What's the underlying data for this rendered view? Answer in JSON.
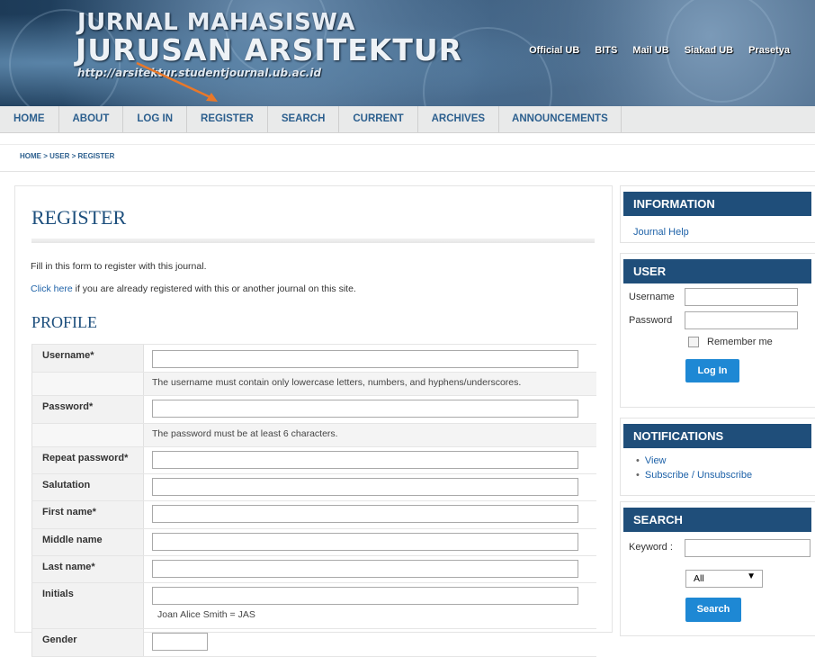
{
  "header": {
    "title_line1": "JURNAL MAHASISWA",
    "title_line2": "JURUSAN ARSITEKTUR",
    "url": "http://arsitektur.studentjournal.ub.ac.id",
    "links": [
      "Official UB",
      "BITS",
      "Mail UB",
      "Siakad UB",
      "Prasetya"
    ]
  },
  "nav": [
    "HOME",
    "ABOUT",
    "LOG IN",
    "REGISTER",
    "SEARCH",
    "CURRENT",
    "ARCHIVES",
    "ANNOUNCEMENTS"
  ],
  "breadcrumb": "HOME > USER > REGISTER",
  "main": {
    "title": "REGISTER",
    "intro": "Fill in this form to register with this journal.",
    "click_link": "Click here",
    "click_rest": " if you are already registered with this or another journal on this site.",
    "section": "PROFILE",
    "fields": {
      "username": "Username*",
      "username_help": "The username must contain only lowercase letters, numbers, and hyphens/underscores.",
      "password": "Password*",
      "password_help": "The password must be at least 6 characters.",
      "repeat_password": "Repeat password*",
      "salutation": "Salutation",
      "first_name": "First name*",
      "middle_name": "Middle name",
      "last_name": "Last name*",
      "initials": "Initials",
      "initials_hint": "Joan Alice Smith = JAS",
      "gender": "Gender"
    }
  },
  "sidebar": {
    "information": {
      "title": "INFORMATION",
      "link": "Journal Help"
    },
    "user": {
      "title": "USER",
      "username_label": "Username",
      "password_label": "Password",
      "remember": "Remember me",
      "login_button": "Log In"
    },
    "notifications": {
      "title": "NOTIFICATIONS",
      "items": [
        "View",
        "Subscribe / Unsubscribe"
      ]
    },
    "search": {
      "title": "SEARCH",
      "keyword_label": "Keyword :",
      "scope": "All",
      "button": "Search"
    }
  }
}
